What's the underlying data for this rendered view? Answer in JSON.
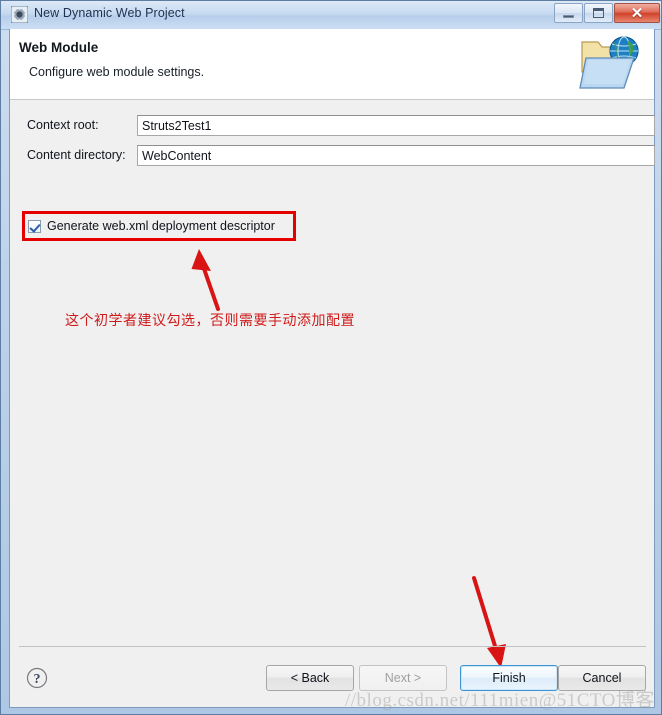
{
  "window": {
    "title": "New Dynamic Web Project",
    "icon": "project-gear-icon",
    "controls": {
      "minimize": "Minimize",
      "maximize": "Maximize",
      "close": "Close",
      "close_glyph": "✕"
    }
  },
  "header": {
    "title": "Web Module",
    "subtitle": "Configure web module settings.",
    "icon": "web-module-folder-globe-icon"
  },
  "form": {
    "fields": [
      {
        "label": "Context root:",
        "value": "Struts2Test1",
        "name": "context-root"
      },
      {
        "label": "Content directory:",
        "value": "WebContent",
        "name": "content-directory"
      }
    ],
    "checkbox": {
      "label": "Generate web.xml deployment descriptor",
      "checked": true
    }
  },
  "annotations": {
    "highlight_color": "#e50000",
    "note_text": "这个初学者建议勾选，否则需要手动添加配置",
    "note_color": "#d01a1a",
    "arrow_up": "arrow-pointing-to-checkbox",
    "arrow_down": "arrow-pointing-to-finish-button"
  },
  "footer": {
    "help": "?",
    "buttons": [
      {
        "label": "< Back",
        "name": "back-button",
        "state": "enabled"
      },
      {
        "label": "Next >",
        "name": "next-button",
        "state": "disabled"
      },
      {
        "label": "Finish",
        "name": "finish-button",
        "state": "default"
      },
      {
        "label": "Cancel",
        "name": "cancel-button",
        "state": "enabled"
      }
    ]
  },
  "watermark": "//blog.csdn.net/111mien@51CTO博客"
}
